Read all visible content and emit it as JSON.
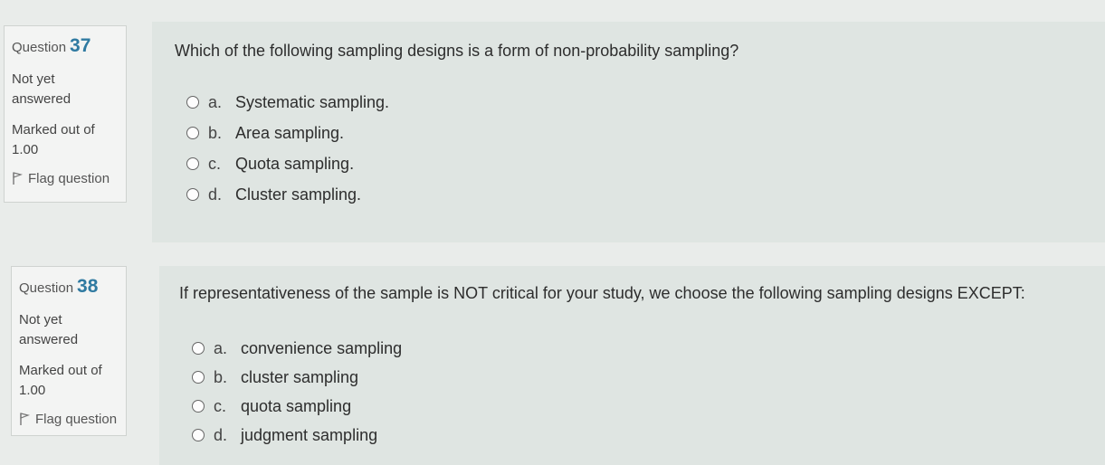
{
  "questions": [
    {
      "label": "Question",
      "number": "37",
      "state_line1": "Not yet",
      "state_line2": "answered",
      "grade_line1": "Marked out of",
      "grade_line2": "1.00",
      "flag_label": "Flag question",
      "text": "Which of the following sampling designs is a form of non-probability sampling?",
      "answers": [
        {
          "letter": "a.",
          "text": "Systematic sampling."
        },
        {
          "letter": "b.",
          "text": "Area sampling."
        },
        {
          "letter": "c.",
          "text": "Quota sampling."
        },
        {
          "letter": "d.",
          "text": "Cluster sampling."
        }
      ]
    },
    {
      "label": "Question",
      "number": "38",
      "state_line1": "Not yet",
      "state_line2": "answered",
      "grade_line1": "Marked out of",
      "grade_line2": "1.00",
      "flag_label": "Flag question",
      "text": "If representativeness of the sample is NOT critical for your study, we choose the following sampling designs EXCEPT:",
      "answers": [
        {
          "letter": "a.",
          "text": "convenience sampling"
        },
        {
          "letter": "b.",
          "text": "cluster sampling"
        },
        {
          "letter": "c.",
          "text": "quota sampling"
        },
        {
          "letter": "d.",
          "text": "judgment sampling"
        }
      ]
    }
  ],
  "colors": {
    "question_number": "#2f7aa1",
    "content_background": "#dfe5e2",
    "info_background": "#f3f4f3"
  },
  "icons": {
    "flag": "flag-icon",
    "radio": "radio-unchecked-icon"
  }
}
